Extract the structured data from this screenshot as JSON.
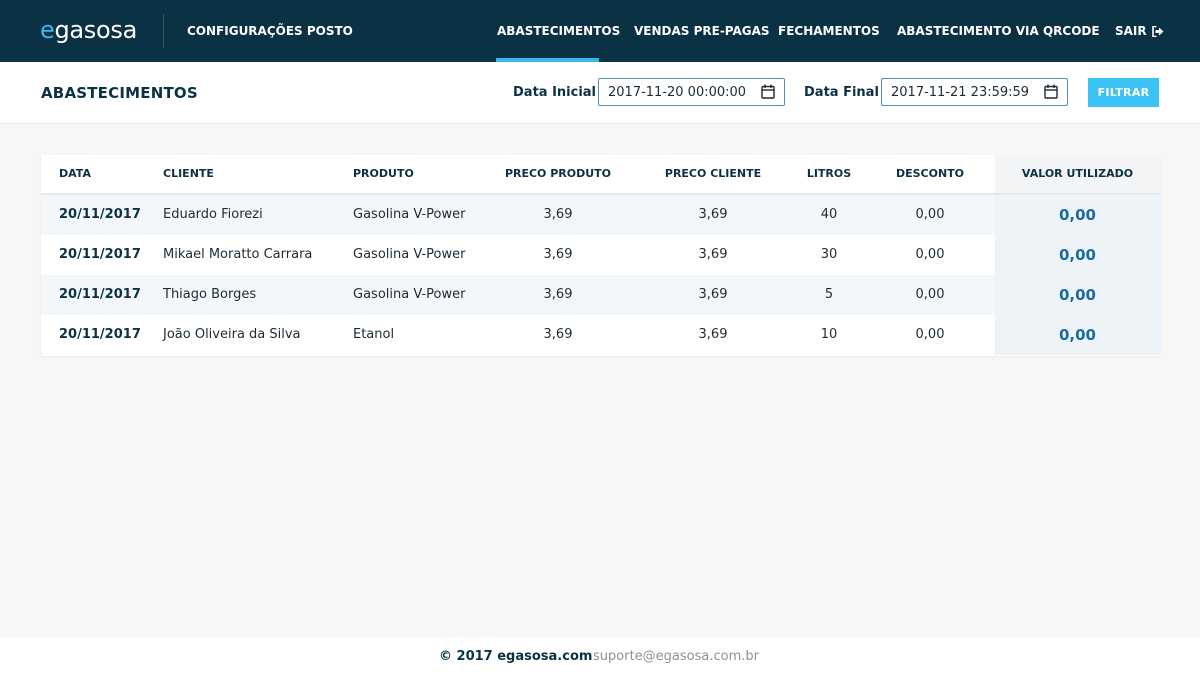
{
  "topbar": {
    "logo_e": "e",
    "logo_rest": "gasosa",
    "config_label": "CONFIGURAÇÕES POSTO",
    "nav": [
      {
        "label": "ABASTECIMENTOS",
        "active": true
      },
      {
        "label": "VENDAS PRE-PAGAS",
        "active": false
      },
      {
        "label": "FECHAMENTOS",
        "active": false
      },
      {
        "label": "ABASTECIMENTO VIA QRCODE",
        "active": false
      }
    ],
    "logout_label": "SAIR",
    "logout_icon": "sign-out-icon"
  },
  "header": {
    "title": "ABASTECIMENTOS",
    "start_label": "Data Inicial",
    "start_value": "2017-11-20 00:00:00",
    "end_label": "Data Final",
    "end_value": "2017-11-21 23:59:59",
    "calendar_icon": "calendar-icon",
    "filter_label": "FILTRAR"
  },
  "table": {
    "columns": [
      "DATA",
      "CLIENTE",
      "PRODUTO",
      "PRECO PRODUTO",
      "PRECO CLIENTE",
      "LITROS",
      "DESCONTO",
      "VALOR UTILIZADO"
    ],
    "rows": [
      {
        "data": "20/11/2017",
        "cliente": "Eduardo Fiorezi",
        "produto": "Gasolina V-Power",
        "preco_produto": "3,69",
        "preco_cliente": "3,69",
        "litros": "40",
        "desconto": "0,00",
        "valor_utilizado": "0,00"
      },
      {
        "data": "20/11/2017",
        "cliente": "Mikael Moratto Carrara",
        "produto": "Gasolina V-Power",
        "preco_produto": "3,69",
        "preco_cliente": "3,69",
        "litros": "30",
        "desconto": "0,00",
        "valor_utilizado": "0,00"
      },
      {
        "data": "20/11/2017",
        "cliente": "Thiago Borges",
        "produto": "Gasolina V-Power",
        "preco_produto": "3,69",
        "preco_cliente": "3,69",
        "litros": "5",
        "desconto": "0,00",
        "valor_utilizado": "0,00"
      },
      {
        "data": "20/11/2017",
        "cliente": "João Oliveira da Silva",
        "produto": "Etanol",
        "preco_produto": "3,69",
        "preco_cliente": "3,69",
        "litros": "10",
        "desconto": "0,00",
        "valor_utilizado": "0,00"
      }
    ]
  },
  "footer": {
    "copyright": "© 2017 egasosa.com",
    "support": "suporte@egasosa.com.br"
  },
  "colors": {
    "navbar": "#0b3145",
    "accent": "#3bb7ee",
    "button": "#3bc3f5",
    "value_text": "#1b6aa0"
  }
}
